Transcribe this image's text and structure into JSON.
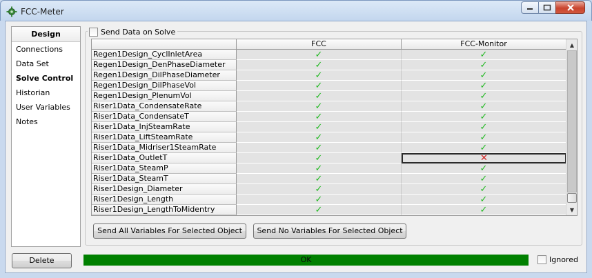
{
  "window": {
    "title": "FCC-Meter",
    "icon": "app-gear-icon"
  },
  "nav": {
    "header": "Design",
    "items": [
      {
        "label": "Connections",
        "active": false
      },
      {
        "label": "Data Set",
        "active": false
      },
      {
        "label": "Solve Control",
        "active": true
      },
      {
        "label": "Historian",
        "active": false
      },
      {
        "label": "User Variables",
        "active": false
      },
      {
        "label": "Notes",
        "active": false
      }
    ]
  },
  "send_on_solve": {
    "label": "Send Data on Solve",
    "checked": false
  },
  "grid": {
    "columns": [
      "FCC",
      "FCC-Monitor"
    ],
    "rows": [
      {
        "name": "Regen1Design_CyclInletArea",
        "fcc": "check",
        "monitor": "check"
      },
      {
        "name": "Regen1Design_DenPhaseDiameter",
        "fcc": "check",
        "monitor": "check"
      },
      {
        "name": "Regen1Design_DilPhaseDiameter",
        "fcc": "check",
        "monitor": "check"
      },
      {
        "name": "Regen1Design_DilPhaseVol",
        "fcc": "check",
        "monitor": "check"
      },
      {
        "name": "Regen1Design_PlenumVol",
        "fcc": "check",
        "monitor": "check"
      },
      {
        "name": "Riser1Data_CondensateRate",
        "fcc": "check",
        "monitor": "check"
      },
      {
        "name": "Riser1Data_CondensateT",
        "fcc": "check",
        "monitor": "check"
      },
      {
        "name": "Riser1Data_InjSteamRate",
        "fcc": "check",
        "monitor": "check"
      },
      {
        "name": "Riser1Data_LiftSteamRate",
        "fcc": "check",
        "monitor": "check"
      },
      {
        "name": "Riser1Data_Midriser1SteamRate",
        "fcc": "check",
        "monitor": "check"
      },
      {
        "name": "Riser1Data_OutletT",
        "fcc": "check",
        "monitor": "cross"
      },
      {
        "name": "Riser1Data_SteamP",
        "fcc": "check",
        "monitor": "check"
      },
      {
        "name": "Riser1Data_SteamT",
        "fcc": "check",
        "monitor": "check"
      },
      {
        "name": "Riser1Design_Diameter",
        "fcc": "check",
        "monitor": "check"
      },
      {
        "name": "Riser1Design_Length",
        "fcc": "check",
        "monitor": "check"
      },
      {
        "name": "Riser1Design_LengthToMidentry",
        "fcc": "check",
        "monitor": "check"
      }
    ],
    "selected_row": 10,
    "selected_column": "FCC-Monitor"
  },
  "buttons": {
    "send_all": "Send All Variables For Selected Object",
    "send_none": "Send No Variables For Selected Object",
    "delete": "Delete"
  },
  "status": {
    "text": "OK",
    "color": "#008000"
  },
  "ignored": {
    "label": "Ignored",
    "checked": false
  }
}
